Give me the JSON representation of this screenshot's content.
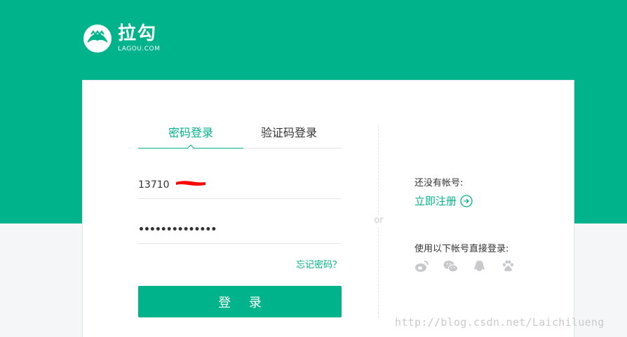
{
  "brand": {
    "name_cn": "拉勾",
    "name_en": "LAGOU.COM"
  },
  "tabs": [
    {
      "label": "密码登录",
      "active": true
    },
    {
      "label": "验证码登录",
      "active": false
    }
  ],
  "form": {
    "phone_value": "13710",
    "password_value": "••••••••••••••",
    "forgot_label": "忘记密码？",
    "login_label": "登 录"
  },
  "divider_label": "or",
  "sidebar": {
    "no_account": "还没有帐号:",
    "register_label": "立即注册",
    "third_party_label": "使用以下帐号直接登录:",
    "social_icons": [
      "weibo-icon",
      "wechat-icon",
      "qq-icon",
      "baidu-icon"
    ]
  },
  "watermark": "http://blog.csdn.net/Laichilueng",
  "colors": {
    "brand_green": "#00b38a",
    "background": "#f5f6f8",
    "redaction": "#ff0000"
  }
}
